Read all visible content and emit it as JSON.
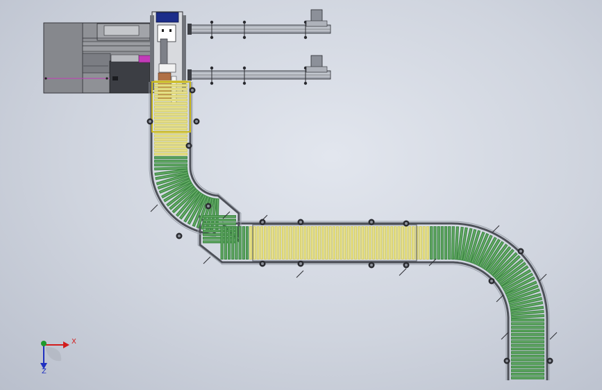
{
  "view": {
    "type": "cad-3d-assembly-top-view",
    "subject": "roller-conveyor-layout",
    "background_color": "#cfd4de"
  },
  "colors": {
    "green_roller": "#3f8a45",
    "green_roller_light": "#6fb46f",
    "yellow_roller": "#d6cf63",
    "yellow_roller_light": "#efe9a4",
    "frame_gray": "#5c5f66",
    "machine_body": "#8f9196",
    "machine_dark": "#3c3e44",
    "panel_blue": "#1c2d8a",
    "accent_magenta": "#c23bb8",
    "axis_x": "#d21c1c",
    "axis_y": "#1f9a2c",
    "axis_z": "#2030c0"
  },
  "components": {
    "machine": "packaging-machine",
    "upper_feeder": "upper-feeder-rail",
    "lower_feeder": "lower-feeder-rail",
    "infeed_section": "yellow-roller-section",
    "curve_1": "curved-roller-section",
    "straight_mid": "straight-roller-section",
    "curve_2": "curved-roller-section",
    "outfeed": "outfeed-roller-section"
  },
  "triad": {
    "x_label": "X",
    "y_label": "",
    "z_label": "Z"
  }
}
